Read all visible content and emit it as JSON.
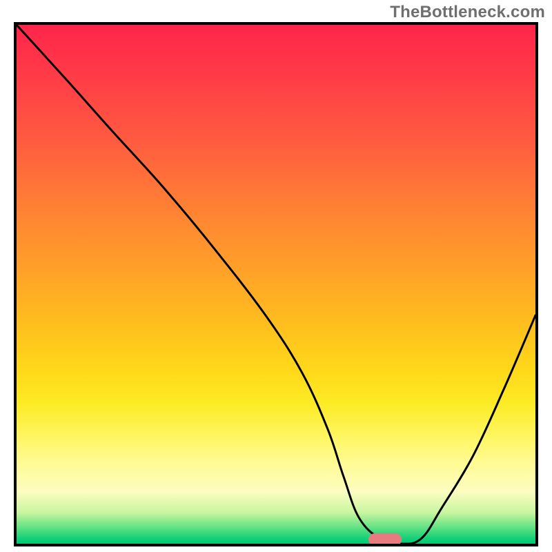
{
  "watermark": "TheBottleneck.com",
  "chart_data": {
    "type": "line",
    "title": "",
    "xlabel": "",
    "ylabel": "",
    "xlim": [
      0,
      100
    ],
    "ylim": [
      0,
      100
    ],
    "background_gradient": {
      "direction": "vertical",
      "stops": [
        {
          "pos": 0,
          "color": "#ff254a"
        },
        {
          "pos": 35,
          "color": "#ff8034"
        },
        {
          "pos": 67,
          "color": "#ffd91a"
        },
        {
          "pos": 85,
          "color": "#fffb99"
        },
        {
          "pos": 97,
          "color": "#5de082"
        },
        {
          "pos": 100,
          "color": "#00c874"
        }
      ]
    },
    "series": [
      {
        "name": "bottleneck-curve",
        "x": [
          0,
          10,
          18,
          28,
          38,
          48,
          55,
          60,
          63,
          66,
          70,
          74,
          78,
          82,
          88,
          94,
          100
        ],
        "y": [
          100,
          89,
          80,
          69,
          57,
          44,
          33,
          22,
          13,
          5,
          1,
          0,
          1,
          7,
          17,
          30,
          44
        ]
      }
    ],
    "marker": {
      "name": "optimal-point",
      "x": 71,
      "y": 0.8,
      "color": "#e77b7f"
    },
    "grid": false,
    "legend": false
  }
}
